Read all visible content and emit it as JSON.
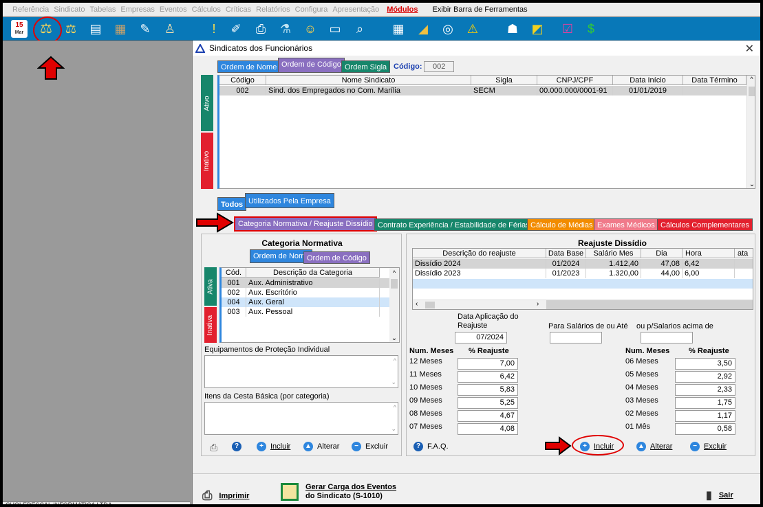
{
  "menu": [
    "Referência",
    "Sindicato",
    "Tabelas",
    "Empresas",
    "Eventos",
    "Cálculos",
    "Críticas",
    "Relatórios",
    "Configura",
    "Apresentação"
  ],
  "menu_modules": "Módulos",
  "menu_toolbar": "Exibir Barra de Ferramentas",
  "calendar": {
    "day": "15",
    "month": "Mar"
  },
  "status_text": "CHOLEDESCAL INFORMATICA LTDA",
  "dialog": {
    "title": "Sindicatos dos Funcionários",
    "order_tabs": [
      "Ordem de Nome",
      "Ordem de Código",
      "Ordem Sigla"
    ],
    "code_label": "Código:",
    "code_value": "002",
    "columns": [
      "Código",
      "Nome Sindicato",
      "Sigla",
      "CNPJ/CPF",
      "Data Início",
      "Data Término"
    ],
    "rows": [
      {
        "codigo": "002",
        "nome": "Sind. dos Empregados no Com. Marília",
        "sigla": "SECM",
        "cnpj": "00.000.000/0001-91",
        "inicio": "01/01/2019",
        "termino": ""
      }
    ],
    "side_tabs": [
      "Ativo",
      "Inativo"
    ],
    "filter_tabs": [
      "Todos",
      "Utilizados Pela Empresa"
    ],
    "main_tabs": [
      "Categoria Normativa / Reajuste Dissídio",
      "Contrato Experiência / Estabilidade de Férias",
      "Cálculo de Médias",
      "Exames Médicos",
      "Cálculos Complementares"
    ]
  },
  "categoria": {
    "title": "Categoria Normativa",
    "order_tabs": [
      "Ordem de Nome",
      "Ordem de Código"
    ],
    "columns": [
      "Cód.",
      "Descrição da Categoria"
    ],
    "rows": [
      {
        "cod": "001",
        "desc": "Aux. Administrativo"
      },
      {
        "cod": "002",
        "desc": "Aux. Escritório"
      },
      {
        "cod": "004",
        "desc": "Aux. Geral"
      },
      {
        "cod": "003",
        "desc": "Aux. Pessoal"
      }
    ],
    "side_tabs": [
      "Ativa",
      "Inativa"
    ],
    "epi_label": "Equipamentos de Proteção Individual",
    "cesta_label": "Itens da Cesta Básica (por categoria)",
    "buttons": [
      "Incluir",
      "Alterar",
      "Excluir"
    ]
  },
  "reajuste": {
    "title": "Reajuste Dissídio",
    "columns": [
      "Descrição do reajuste",
      "Data Base",
      "Salário Mes",
      "Dia",
      "Hora",
      "ata"
    ],
    "rows": [
      {
        "desc": "Dissídio 2024",
        "base": "01/2024",
        "salario": "1.412,40",
        "dia": "47,08",
        "hora": "6,42"
      },
      {
        "desc": "Dissídio 2023",
        "base": "01/2023",
        "salario": "1.320,00",
        "dia": "44,00",
        "hora": "6,00"
      }
    ],
    "data_aplicacao_label": "Data Aplicação do Reajuste",
    "data_aplicacao_value": "07/2024",
    "salarios_ate_label": "Para Salários de ou Até",
    "salarios_acima_label": "ou p/Salarios acima de",
    "num_meses_label": "Num. Meses",
    "pct_label": "% Reajuste",
    "left_months": [
      {
        "m": "12 Meses",
        "v": "7,00"
      },
      {
        "m": "11 Meses",
        "v": "6,42"
      },
      {
        "m": "10 Meses",
        "v": "5,83"
      },
      {
        "m": "09 Meses",
        "v": "5,25"
      },
      {
        "m": "08 Meses",
        "v": "4,67"
      },
      {
        "m": "07 Meses",
        "v": "4,08"
      }
    ],
    "right_months": [
      {
        "m": "06 Meses",
        "v": "3,50"
      },
      {
        "m": "05 Meses",
        "v": "2,92"
      },
      {
        "m": "04 Meses",
        "v": "2,33"
      },
      {
        "m": "03 Meses",
        "v": "1,75"
      },
      {
        "m": "02 Meses",
        "v": "1,17"
      },
      {
        "m": "01 Mês",
        "v": "0,58"
      }
    ],
    "faq": "F.A.Q.",
    "buttons": [
      "Incluir",
      "Alterar",
      "Excluir"
    ]
  },
  "footer": {
    "print": "Imprimir",
    "gerar_line1": "Gerar Carga dos Eventos",
    "gerar_line2": "do Sindicato (S-1010)",
    "exit": "Sair"
  },
  "colors": {
    "toolbar": "#0878b8",
    "tab_purple": "#8a6fc0",
    "tab_blue": "#2e86de",
    "active_green": "#17866b",
    "inactive_red": "#e2202e",
    "annotation": "#e00000"
  }
}
